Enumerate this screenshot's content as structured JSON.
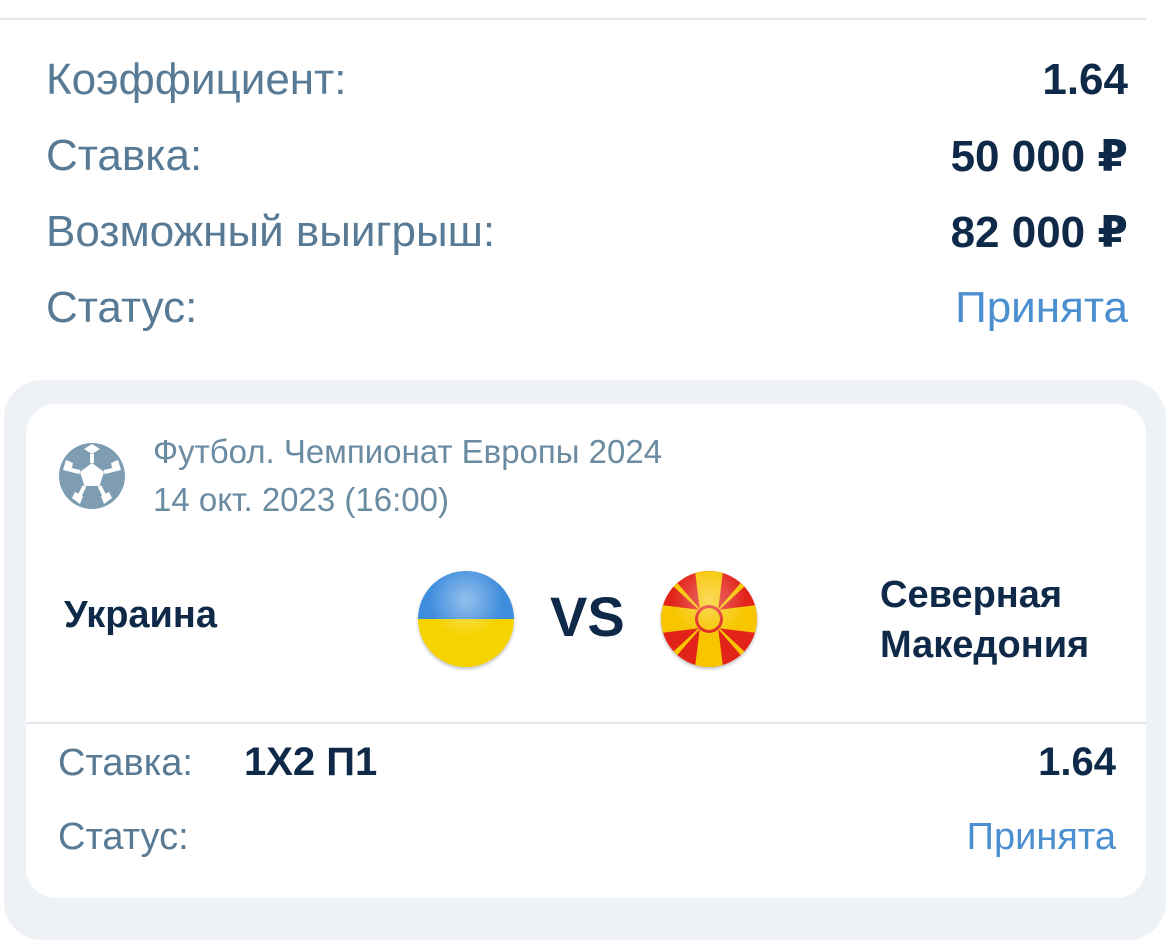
{
  "summary": {
    "odds_label": "Коэффициент:",
    "odds_value": "1.64",
    "stake_label": "Ставка:",
    "stake_value": "50 000 ₽",
    "payout_label": "Возможный выигрыш:",
    "payout_value": "82 000 ₽",
    "status_label": "Статус:",
    "status_value": "Принята"
  },
  "event": {
    "sport_icon": "soccer-ball-icon",
    "tournament": "Футбол. Чемпионат Европы 2024",
    "datetime": "14 окт. 2023 (16:00)",
    "home_team": "Украина",
    "home_flag": "ukraine-flag-icon",
    "vs": "VS",
    "away_team_line1": "Северная",
    "away_team_line2": "Македония",
    "away_flag": "north-macedonia-flag-icon"
  },
  "bet": {
    "label": "Ставка:",
    "market": "1X2 П1",
    "odds": "1.64",
    "status_label": "Статус:",
    "status_value": "Принята"
  },
  "colors": {
    "primary_text": "#0e2a48",
    "secondary_text": "#587a94",
    "status_accent": "#4b8fd0",
    "panel_background": "#eef1f5"
  }
}
